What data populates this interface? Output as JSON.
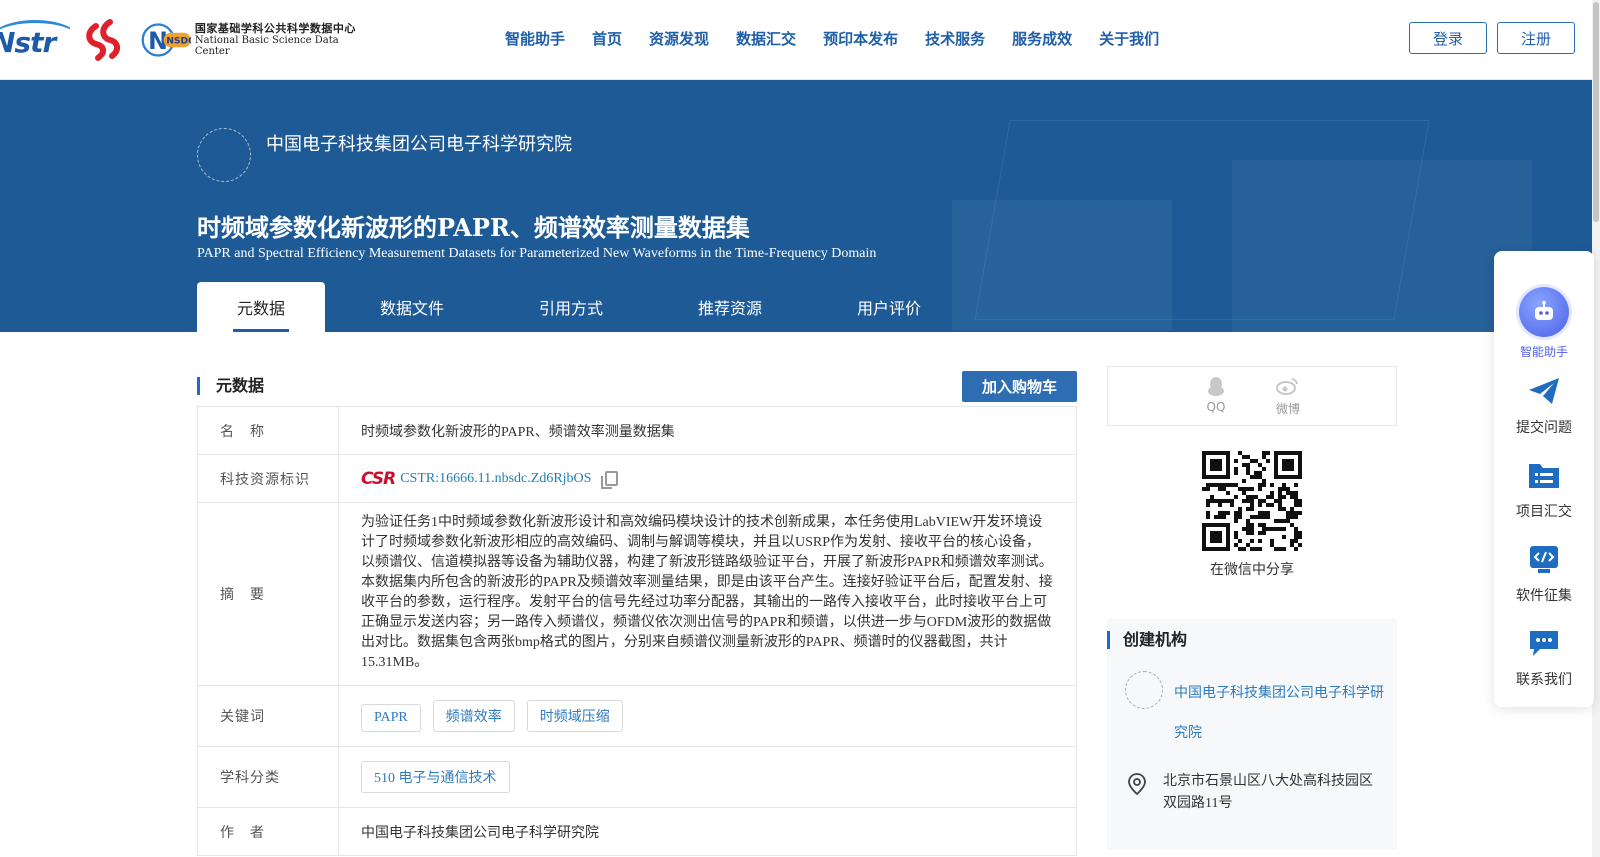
{
  "nav": {
    "items": [
      "智能助手",
      "首页",
      "资源发现",
      "数据汇交",
      "预印本发布",
      "技术服务",
      "服务成效",
      "关于我们"
    ],
    "login": "登录",
    "register": "注册"
  },
  "logos": {
    "nstr_text": "Nstr",
    "nsdc_badge": "NSDC",
    "nsdc_cn": "国家基础学科公共科学数据中心",
    "nsdc_en": "National Basic Science Data Center"
  },
  "banner": {
    "org_name": "中国电子科技集团公司电子科学研究院",
    "title_cn": "时频域参数化新波形的PAPR、频谱效率测量数据集",
    "title_en": "PAPR and Spectral Efficiency Measurement Datasets for Parameterized New Waveforms in the Time-Frequency Domain",
    "tabs": [
      "元数据",
      "数据文件",
      "引用方式",
      "推荐资源",
      "用户评价"
    ]
  },
  "metadata": {
    "section_title": "元数据",
    "cart_button": "加入购物车",
    "rows": {
      "name": {
        "label": "名　称",
        "value": "时频域参数化新波形的PAPR、频谱效率测量数据集"
      },
      "cstr": {
        "label": "科技资源标识",
        "logo": "CSR",
        "value": "CSTR:16666.11.nbsdc.Zd6RjbOS"
      },
      "abstract": {
        "label": "摘　要",
        "value": "为验证任务1中时频域参数化新波形设计和高效编码模块设计的技术创新成果，本任务使用LabVIEW开发环境设计了时频域参数化新波形相应的高效编码、调制与解调等模块，并且以USRP作为发射、接收平台的核心设备，以频谱仪、信道模拟器等设备为辅助仪器，构建了新波形链路级验证平台，开展了新波形PAPR和频谱效率测试。本数据集内所包含的新波形的PAPR及频谱效率测量结果，即是由该平台产生。连接好验证平台后，配置发射、接收平台的参数，运行程序。发射平台的信号先经过功率分配器，其输出的一路传入接收平台，此时接收平台上可正确显示发送内容；另一路传入频谱仪，频谱仪依次测出信号的PAPR和频谱，以供进一步与OFDM波形的数据做出对比。数据集包含两张bmp格式的图片，分别来自频谱仪测量新波形的PAPR、频谱时的仪器截图，共计15.31MB。"
      },
      "keywords": {
        "label": "关键词",
        "tags": [
          "PAPR",
          "频谱效率",
          "时频域压缩"
        ]
      },
      "subject": {
        "label": "学科分类",
        "tags": [
          "510 电子与通信技术"
        ]
      },
      "author": {
        "label": "作　者",
        "value": "中国电子科技集团公司电子科学研究院"
      }
    }
  },
  "share": {
    "qq": "QQ",
    "weibo": "微博",
    "wechat_label": "在微信中分享"
  },
  "institution": {
    "title": "创建机构",
    "name": "中国电子科技集团公司电子科学研究院",
    "address": "北京市石景山区八大处高科技园区双园路11号"
  },
  "float_bar": {
    "items": [
      "智能助手",
      "提交问题",
      "项目汇交",
      "软件征集",
      "联系我们"
    ]
  },
  "colors": {
    "brand_blue": "#1f5fa8",
    "banner_bg": "#1e5b96",
    "cart_button": "#2e6db1",
    "link": "#2e7bc0"
  }
}
